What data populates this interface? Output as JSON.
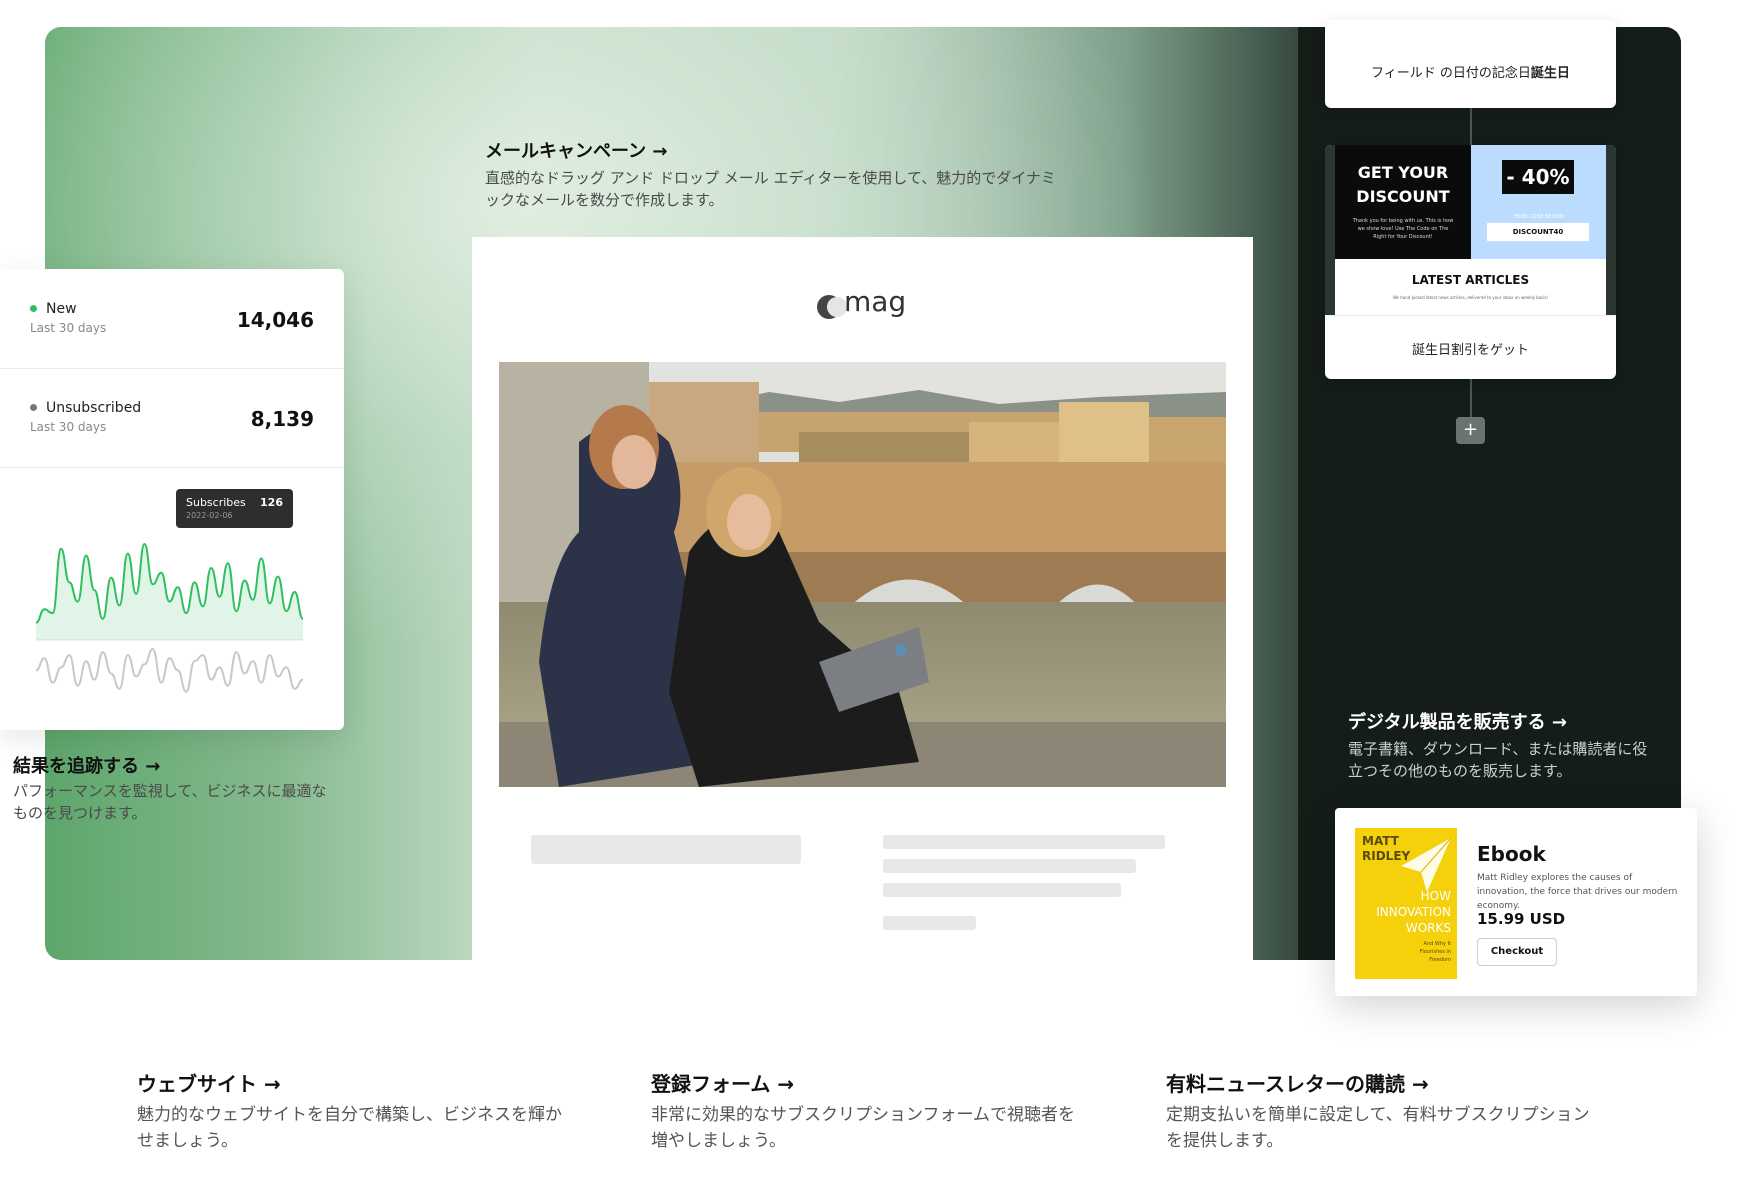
{
  "features": {
    "email": {
      "title": "メールキャンペーン →",
      "desc": "直感的なドラッグ アンド ドロップ メール エディターを使用して、魅力的でダイナミックなメールを数分で作成します。"
    },
    "tracking": {
      "title": "結果を追跡する →",
      "desc": "パフォーマンスを監視して、ビジネスに最適なものを見つけます。"
    },
    "digital": {
      "title": "デジタル製品を販売する →",
      "desc": "電子書籍、ダウンロード、または購読者に役立つその他のものを販売します。"
    }
  },
  "stats": {
    "new_label": "New",
    "new_sub": "Last 30 days",
    "new_value": "14,046",
    "unsub_label": "Unsubscribed",
    "unsub_sub": "Last 30 days",
    "unsub_value": "8,139",
    "tooltip_label": "Subscribes",
    "tooltip_value": "126",
    "tooltip_date": "2022-02-06",
    "colors": {
      "new": "#2fbf5f",
      "unsubscribed": "#777777"
    }
  },
  "chart_data": {
    "type": "line",
    "series": [
      {
        "values": [
          18,
          32,
          28,
          95,
          60,
          40,
          88,
          52,
          22,
          65,
          36,
          90,
          48,
          100,
          58,
          70,
          40,
          55,
          28,
          60,
          35,
          75,
          45,
          80,
          30,
          62,
          42,
          85,
          38,
          66,
          30,
          50,
          22
        ]
      },
      {
        "values": [
          20,
          28,
          12,
          22,
          30,
          10,
          26,
          14,
          32,
          18,
          8,
          30,
          16,
          24,
          34,
          12,
          28,
          20,
          6,
          26,
          30,
          14,
          22,
          10,
          32,
          18,
          26,
          12,
          30,
          16,
          22,
          8,
          14
        ]
      }
    ]
  },
  "email_preview": {
    "logo_text": "mag"
  },
  "automation": {
    "trigger_text_pre": "フィールド の日付の記念日",
    "trigger_text_bold": "誕生日",
    "promo_title_1": "GET YOUR",
    "promo_title_2": "DISCOUNT",
    "promo_small": "Thank you for being with us. This is how we show love! Use The Code on The Right for Your Discount!",
    "promo_percent": "- 40%",
    "promo_code_label": "YOUR CODE BELOW",
    "promo_code": "DISCOUNT40",
    "articles_title": "LATEST ARTICLES",
    "articles_small": "We hand picked latest news articles, delivered to your inbox on weekly basis!",
    "step_label": "誕生日割引をゲット",
    "add_icon": "+"
  },
  "ebook": {
    "type_label": "Ebook",
    "desc": "Matt Ridley explores the causes of innovation, the force that drives our modern economy.",
    "price": "15.99 USD",
    "cta": "Checkout",
    "cover_author_1": "MATT",
    "cover_author_2": "RIDLEY",
    "cover_title_1": "HOW",
    "cover_title_2": "INNOVATION",
    "cover_title_3": "WORKS",
    "cover_sub": "And Why It Flourishes in Freedom"
  },
  "bottom": [
    {
      "title": "ウェブサイト →",
      "desc": "魅力的なウェブサイトを自分で構築し、ビジネスを輝かせましょう。"
    },
    {
      "title": "登録フォーム →",
      "desc": "非常に効果的なサブスクリプションフォームで視聴者を増やしましょう。"
    },
    {
      "title": "有料ニュースレターの購読 →",
      "desc": "定期支払いを簡単に設定して、有料サブスクリプションを提供します。"
    }
  ]
}
